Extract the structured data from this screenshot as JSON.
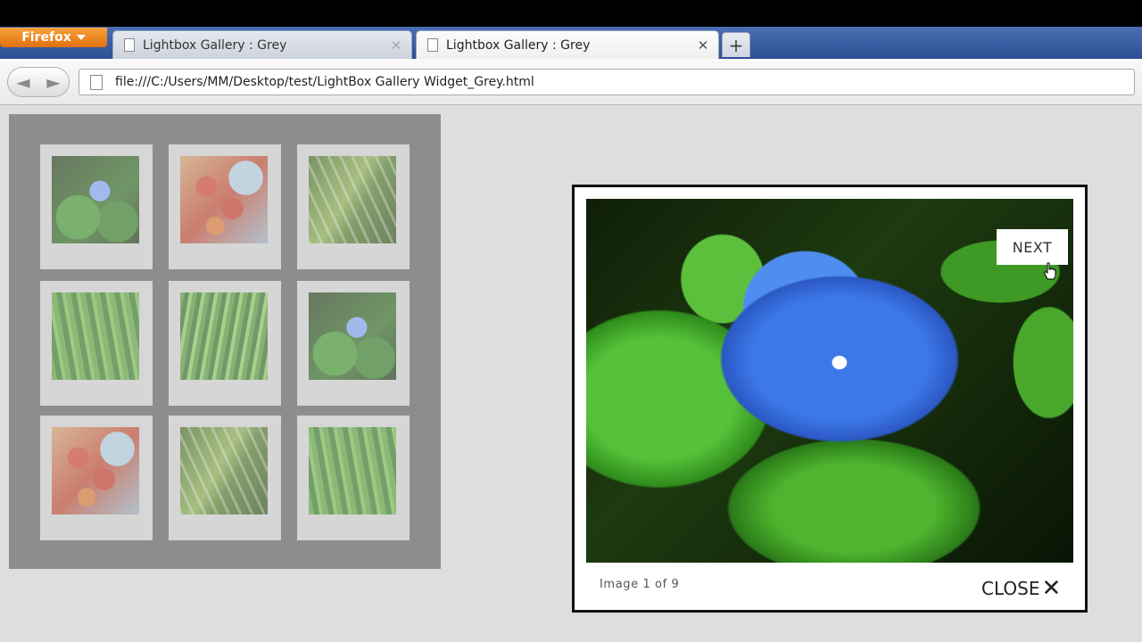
{
  "browser": {
    "menu_button": "Firefox",
    "tabs": [
      {
        "title": "Lightbox Gallery : Grey",
        "active": false
      },
      {
        "title": "Lightbox Gallery : Grey",
        "active": true
      }
    ],
    "close_glyph": "✕",
    "new_tab_glyph": "+",
    "back_glyph": "◄",
    "forward_glyph": "►",
    "url": "file:///C:/Users/MM/Desktop/test/LightBox Gallery Widget_Grey.html"
  },
  "gallery": {
    "thumbnails": [
      {
        "subject": "blue-flower"
      },
      {
        "subject": "red-leaves"
      },
      {
        "subject": "leaf-droplets"
      },
      {
        "subject": "grass"
      },
      {
        "subject": "grass-blades"
      },
      {
        "subject": "blue-flower"
      },
      {
        "subject": "red-leaves"
      },
      {
        "subject": "leaf-droplets"
      },
      {
        "subject": "grass"
      }
    ]
  },
  "lightbox": {
    "image_subject": "blue-flower",
    "next_label": "NEXT",
    "caption": "Image 1 of 9",
    "close_label": "CLOSE",
    "close_glyph": "✕"
  },
  "colors": {
    "tabstrip_blue": "#2c4f94",
    "firefox_orange": "#e0710f",
    "page_background": "#dedede",
    "gallery_panel": "#8d8d8d"
  }
}
